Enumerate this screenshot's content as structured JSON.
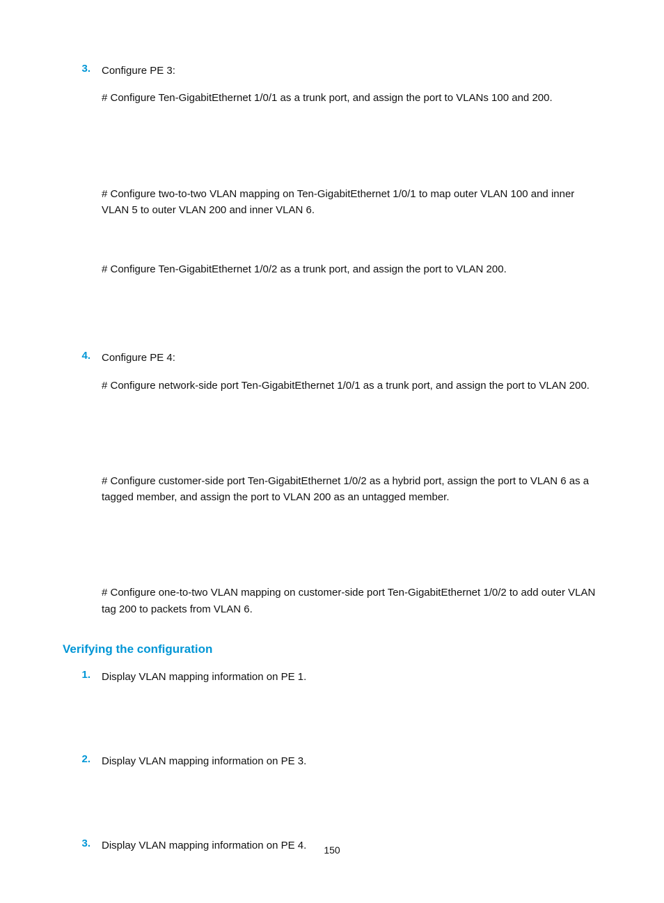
{
  "steps_a": [
    {
      "num": "3.",
      "title": "Configure PE 3:",
      "paras": [
        "# Configure Ten-GigabitEthernet 1/0/1 as a trunk port, and assign the port to VLANs 100 and 200.",
        "# Configure two-to-two VLAN mapping on Ten-GigabitEthernet 1/0/1 to map outer VLAN 100 and inner VLAN 5 to outer VLAN 200 and inner VLAN 6.",
        "# Configure Ten-GigabitEthernet 1/0/2 as a trunk port, and assign the port to VLAN 200."
      ],
      "gaps": [
        "gap-lg",
        "gap-md",
        "gap-lg"
      ]
    },
    {
      "num": "4.",
      "title": "Configure PE 4:",
      "paras": [
        "# Configure network-side port Ten-GigabitEthernet 1/0/1 as a trunk port, and assign the port to VLAN 200.",
        "# Configure customer-side port Ten-GigabitEthernet 1/0/2 as a hybrid port, assign the port to VLAN 6 as a tagged member, and assign the port to VLAN 200 as an untagged member.",
        "# Configure one-to-two VLAN mapping on customer-side port Ten-GigabitEthernet 1/0/2 to add outer VLAN tag 200 to packets from VLAN 6."
      ],
      "gaps": [
        "gap-lg",
        "gap-lg",
        ""
      ]
    }
  ],
  "heading": "Verifying the configuration",
  "steps_b": [
    {
      "num": "1.",
      "text": "Display VLAN mapping information on PE 1."
    },
    {
      "num": "2.",
      "text": "Display VLAN mapping information on PE 3."
    },
    {
      "num": "3.",
      "text": "Display VLAN mapping information on PE 4."
    }
  ],
  "page_number": "150"
}
